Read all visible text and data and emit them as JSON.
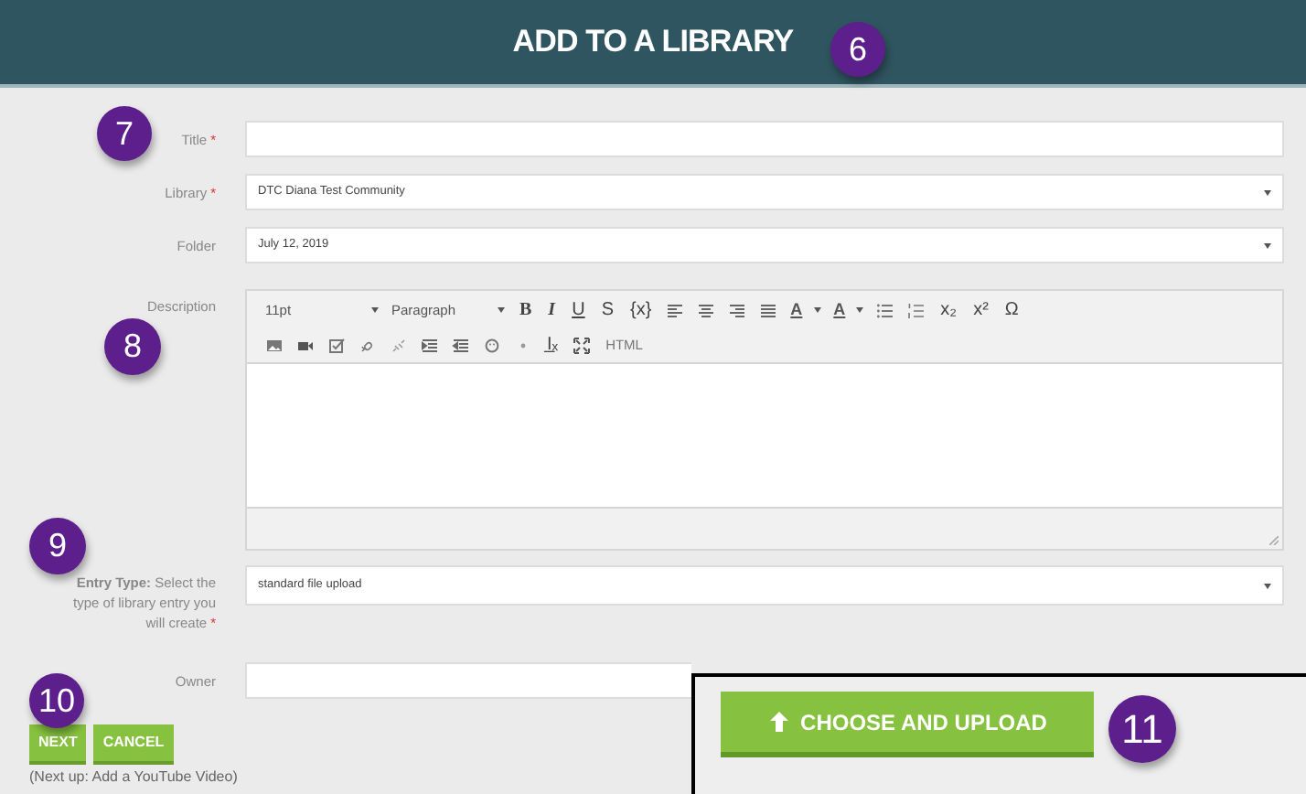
{
  "header": {
    "title": "ADD TO A LIBRARY"
  },
  "form": {
    "fields": [
      {
        "kind": "text",
        "label": "Title",
        "required_mark": "*"
      },
      {
        "kind": "select",
        "label": "Library",
        "required_mark": "*",
        "value": "DTC Diana Test Community"
      },
      {
        "kind": "select",
        "label": "Folder",
        "value": "July 12, 2019"
      },
      {
        "kind": "editor",
        "label": "Description"
      },
      {
        "kind": "select",
        "label": "**Entry Type:** Select the type of library entry you will create",
        "required_mark": "*",
        "value": "standard file upload"
      },
      {
        "kind": "text",
        "label": "Owner"
      }
    ]
  },
  "editor_toolbar": [
    [
      {
        "kind": "select",
        "label": "11pt"
      },
      {
        "kind": "select",
        "label": "Paragraph"
      },
      {
        "kind": "char",
        "label": "B"
      },
      {
        "kind": "char",
        "label": "I"
      },
      {
        "kind": "char",
        "label": "U"
      },
      {
        "kind": "char",
        "label": "S"
      },
      {
        "kind": "char",
        "label": "{x}"
      },
      {
        "kind": "icon"
      },
      {
        "kind": "icon"
      },
      {
        "kind": "icon"
      },
      {
        "kind": "icon"
      },
      {
        "kind": "select",
        "label": "A"
      },
      {
        "kind": "select",
        "label": "A"
      },
      {
        "kind": "icon"
      },
      {
        "kind": "icon"
      },
      {
        "kind": "char",
        "label": "x₂"
      },
      {
        "kind": "char",
        "label": "x²"
      },
      {
        "kind": "char",
        "label": "Ω"
      }
    ],
    [
      {
        "kind": "icon"
      },
      {
        "kind": "icon"
      },
      {
        "kind": "icon"
      },
      {
        "kind": "icon"
      },
      {
        "kind": "icon"
      },
      {
        "kind": "icon"
      },
      {
        "kind": "icon"
      },
      {
        "kind": "icon"
      },
      {
        "kind": "icon"
      },
      {
        "kind": "char",
        "label": "I̲ₓ"
      },
      {
        "kind": "icon"
      },
      {
        "kind": "char",
        "label": "HTML"
      }
    ]
  ],
  "buttons": [
    {
      "label": "NEXT"
    },
    {
      "label": "CANCEL"
    }
  ],
  "next_up": "(Next up: Add a YouTube Video)",
  "callout": {
    "button": "CHOOSE AND UPLOAD"
  },
  "step_badges": [
    "6",
    "7",
    "8",
    "9",
    "10",
    "11"
  ]
}
